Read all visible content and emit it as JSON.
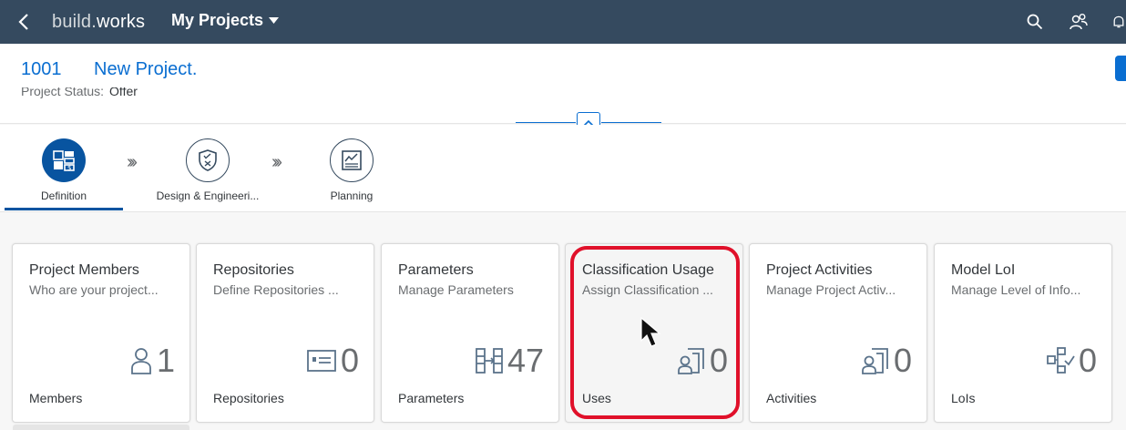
{
  "shell": {
    "logo_part1": "build",
    "logo_dot": ".",
    "logo_part2": "works",
    "title": "My Projects",
    "icons": [
      "back-icon",
      "search-icon",
      "people-icon",
      "bell-icon",
      "caret-down-icon"
    ]
  },
  "header": {
    "project_id": "1001",
    "project_name": "New Project.",
    "status_label": "Project Status:",
    "status_value": "Offer"
  },
  "process_flow": {
    "steps": [
      {
        "label": "Definition",
        "icon": "definition-icon",
        "active": true
      },
      {
        "label": "Design & Engineeri...",
        "icon": "shield-check-icon",
        "active": false
      },
      {
        "label": "Planning",
        "icon": "planning-board-icon",
        "active": false
      }
    ],
    "separator": "›››"
  },
  "tiles": [
    {
      "title": "Project Members",
      "subtitle": "Who are your project...",
      "value": "1",
      "footer": "Members",
      "icon": "person-icon"
    },
    {
      "title": "Repositories",
      "subtitle": "Define Repositories ...",
      "value": "0",
      "footer": "Repositories",
      "icon": "id-card-icon"
    },
    {
      "title": "Parameters",
      "subtitle": "Manage Parameters",
      "value": "47",
      "footer": "Parameters",
      "icon": "parameters-icon"
    },
    {
      "title": "Classification Usage",
      "subtitle": "Assign Classification ...",
      "value": "0",
      "footer": "Uses",
      "icon": "user-doc-icon"
    },
    {
      "title": "Project Activities",
      "subtitle": "Manage Project Activ...",
      "value": "0",
      "footer": "Activities",
      "icon": "user-doc-icon"
    },
    {
      "title": "Model LoI",
      "subtitle": "Manage Level of Info...",
      "value": "0",
      "footer": "LoIs",
      "icon": "hierarchy-check-icon"
    }
  ],
  "colors": {
    "shell_bg": "#354a5f",
    "link": "#0a6ed1",
    "active_step": "#0854a0",
    "highlight": "#e0102a"
  }
}
